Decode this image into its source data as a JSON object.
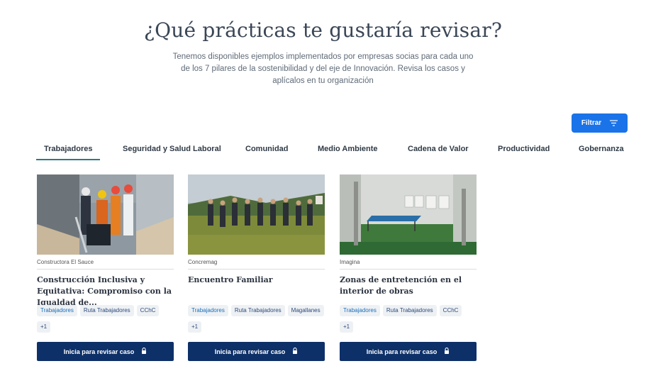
{
  "header": {
    "title": "¿Qué prácticas te gustaría revisar?",
    "subtitle": "Tenemos disponibles ejemplos implementados por empresas socias para cada uno de los 7 pilares de la sostenibilidad y del eje de Innovación. Revisa los casos y aplícalos en tu organización"
  },
  "filter": {
    "label": "Filtrar",
    "icon": "filter-icon"
  },
  "tabs": [
    {
      "label": "Trabajadores",
      "active": true
    },
    {
      "label": "Seguridad y Salud Laboral",
      "active": false
    },
    {
      "label": "Comunidad",
      "active": false
    },
    {
      "label": "Medio Ambiente",
      "active": false
    },
    {
      "label": "Cadena de Valor",
      "active": false
    },
    {
      "label": "Productividad",
      "active": false
    },
    {
      "label": "Gobernanza",
      "active": false
    }
  ],
  "cards": [
    {
      "company": "Constructora El Sauce",
      "title": "Construcción Inclusiva y Equitativa: Compromiso con la Igualdad de...",
      "tags": [
        "Trabajadores",
        "Ruta Trabajadores",
        "CChC",
        "+1"
      ],
      "cta": "Inicia para revisar caso",
      "cta_icon": "lock-icon"
    },
    {
      "company": "Concremag",
      "title": "Encuentro Familiar",
      "tags": [
        "Trabajadores",
        "Ruta Trabajadores",
        "Magallanes",
        "+1"
      ],
      "cta": "Inicia para revisar caso",
      "cta_icon": "lock-icon"
    },
    {
      "company": "Imagina",
      "title": "Zonas de entretención en el interior de obras",
      "tags": [
        "Trabajadores",
        "Ruta Trabajadores",
        "CChC",
        "+1"
      ],
      "cta": "Inicia para revisar caso",
      "cta_icon": "lock-icon"
    }
  ],
  "colors": {
    "primary_button": "#1a73e8",
    "cta_button": "#0d3068",
    "active_tab_underline": "#2a7b86",
    "tag_text": "#1a6fb8"
  }
}
